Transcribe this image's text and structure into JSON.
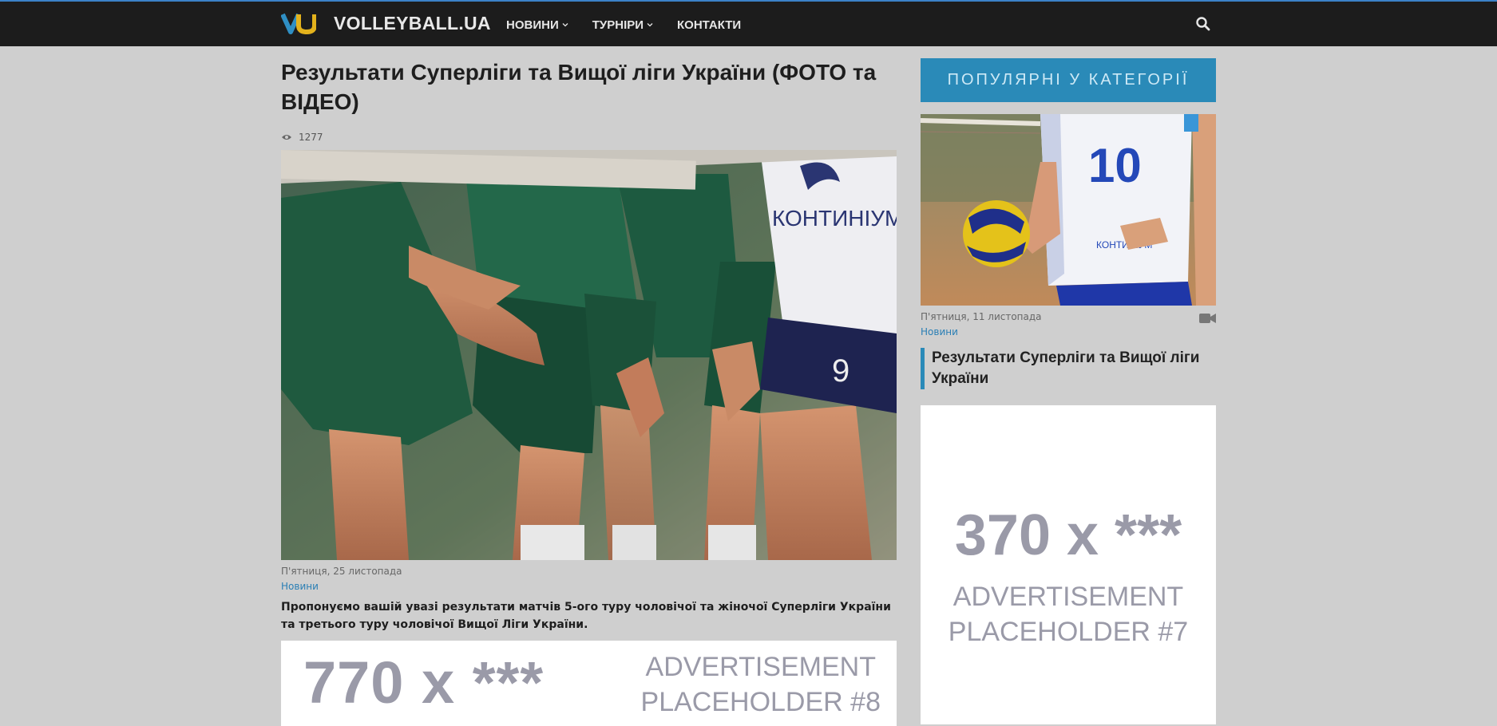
{
  "header": {
    "logo_text": "VOLLEYBALL.UA",
    "nav": [
      {
        "label": "НОВИНИ",
        "has_dropdown": true
      },
      {
        "label": "ТУРНІРИ",
        "has_dropdown": true
      },
      {
        "label": "КОНТАКТИ",
        "has_dropdown": false
      }
    ],
    "search_icon": "search-icon"
  },
  "article": {
    "title": "Результати Суперліги та Вищої ліги України (ФОТО та ВІДЕО)",
    "views": "1277",
    "date": "П'ятниця, 25 листопада",
    "category": "Новини",
    "lead": "Пропонуємо вашій увазі результати матчів 5-ого туру чоловічої та жіночої Суперліги України та третього туру чоловічої Вищої Ліги України.",
    "photo_jersey_text": "КОНТИНІУМ",
    "photo_number": "9"
  },
  "ad_wide": {
    "size": "770 x ***",
    "line1": "ADVERTISEMENT",
    "line2": "PLACEHOLDER #8"
  },
  "sidebar": {
    "heading": "ПОПУЛЯРНІ У КАТЕГОРІЇ",
    "item": {
      "date": "П'ятниця, 11 листопада",
      "category": "Новини",
      "title": "Результати Суперліги та Вищої ліги України",
      "jersey_number": "10",
      "jersey_text": "КОНТИНІУМ"
    },
    "ad": {
      "size": "370 x ***",
      "line1": "ADVERTISEMENT",
      "line2": "PLACEHOLDER #7"
    }
  },
  "colors": {
    "accent": "#2a8ab8",
    "topbar": "#1c1c1c",
    "link": "#2a7fb5"
  }
}
